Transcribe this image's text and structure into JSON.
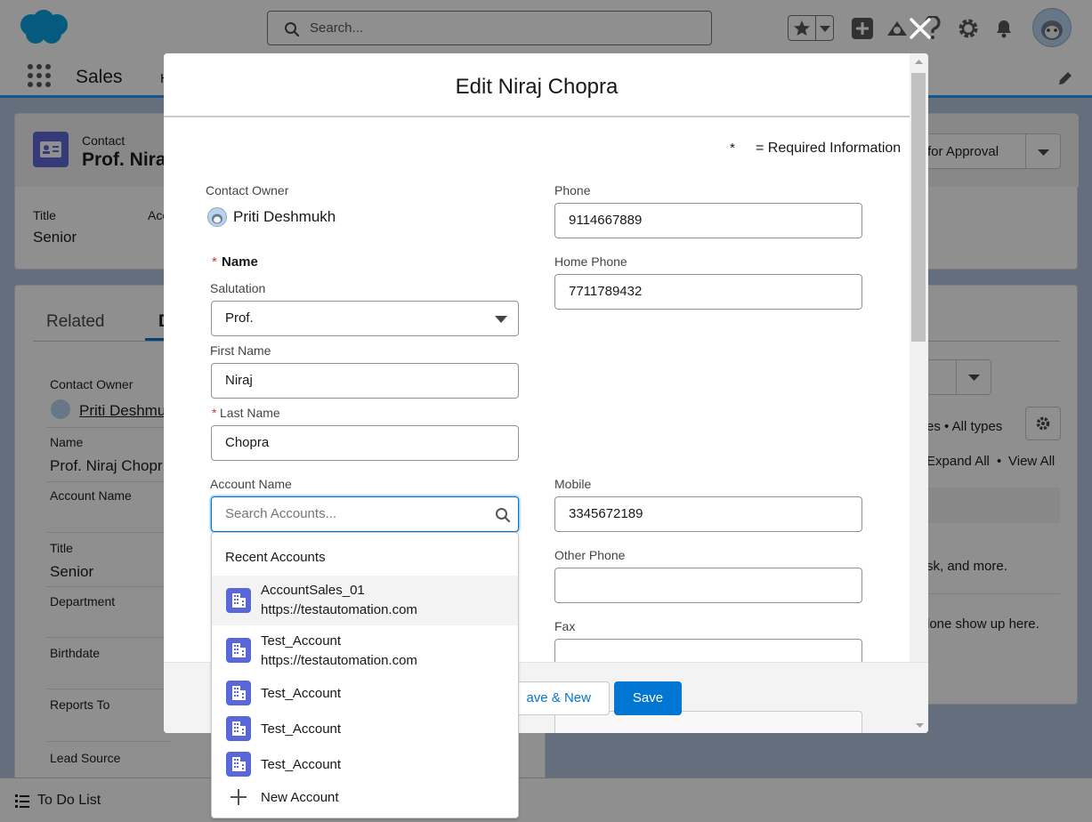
{
  "global_header": {
    "search_placeholder": "Search..."
  },
  "app_nav": {
    "app_name": "Sales",
    "partial_tab": "H"
  },
  "record_header": {
    "object_label": "Contact",
    "record_name_partial": "Prof. Nira",
    "approval_button_partial": "for Approval",
    "title_label": "Title",
    "title_value": "Senior",
    "account_label_partial": "Acc"
  },
  "detail_tabs": {
    "related": "Related",
    "details_partial": "D"
  },
  "details": {
    "contact_owner_label": "Contact Owner",
    "contact_owner_value": "Priti Deshmu",
    "name_label": "Name",
    "name_value": "Prof. Niraj Chopr",
    "account_name_label": "Account Name",
    "title_label": "Title",
    "title_value": "Senior",
    "department_label": "Department",
    "birthdate_label": "Birthdate",
    "reports_to_label": "Reports To",
    "lead_source_label": "Lead Source"
  },
  "activity_panel": {
    "filter_text": "es • All types",
    "expand_all": "Expand All",
    "bullet": "•",
    "view_all": "View All",
    "empty_text_1": "sk, and more.",
    "empty_text_2": "lone show up here."
  },
  "utility_bar": {
    "todo_label": "To Do List"
  },
  "modal": {
    "title": "Edit Niraj Chopra",
    "required_marker": "*",
    "required_text": "= Required Information",
    "contact_owner_label": "Contact Owner",
    "contact_owner_value": "Priti Deshmukh",
    "name_section_label": "Name",
    "salutation_label": "Salutation",
    "salutation_value": "Prof.",
    "first_name_label": "First Name",
    "first_name_value": "Niraj",
    "last_name_label": "Last Name",
    "last_name_value": "Chopra",
    "account_name_label": "Account Name",
    "account_search_placeholder": "Search Accounts...",
    "phone_label": "Phone",
    "phone_value": "9114667889",
    "home_phone_label": "Home Phone",
    "home_phone_value": "7711789432",
    "mobile_label": "Mobile",
    "mobile_value": "3345672189",
    "other_phone_label": "Other Phone",
    "other_phone_value": "",
    "fax_label": "Fax",
    "fax_value": "",
    "save_new_partial": "ave & New",
    "save_label": "Save"
  },
  "account_dropdown": {
    "header": "Recent Accounts",
    "items": [
      {
        "title": "AccountSales_01",
        "subtitle": "https://testautomation.com"
      },
      {
        "title": "Test_Account",
        "subtitle": "https://testautomation.com"
      },
      {
        "title": "Test_Account",
        "subtitle": ""
      },
      {
        "title": "Test_Account",
        "subtitle": ""
      },
      {
        "title": "Test_Account",
        "subtitle": ""
      }
    ],
    "new_account_label": "New Account"
  },
  "colors": {
    "brand_blue": "#0176d3",
    "link_blue": "#0b5cab",
    "account_icon": "#5a67d8",
    "contact_icon": "#5a67d8",
    "required_red": "#c23934"
  }
}
